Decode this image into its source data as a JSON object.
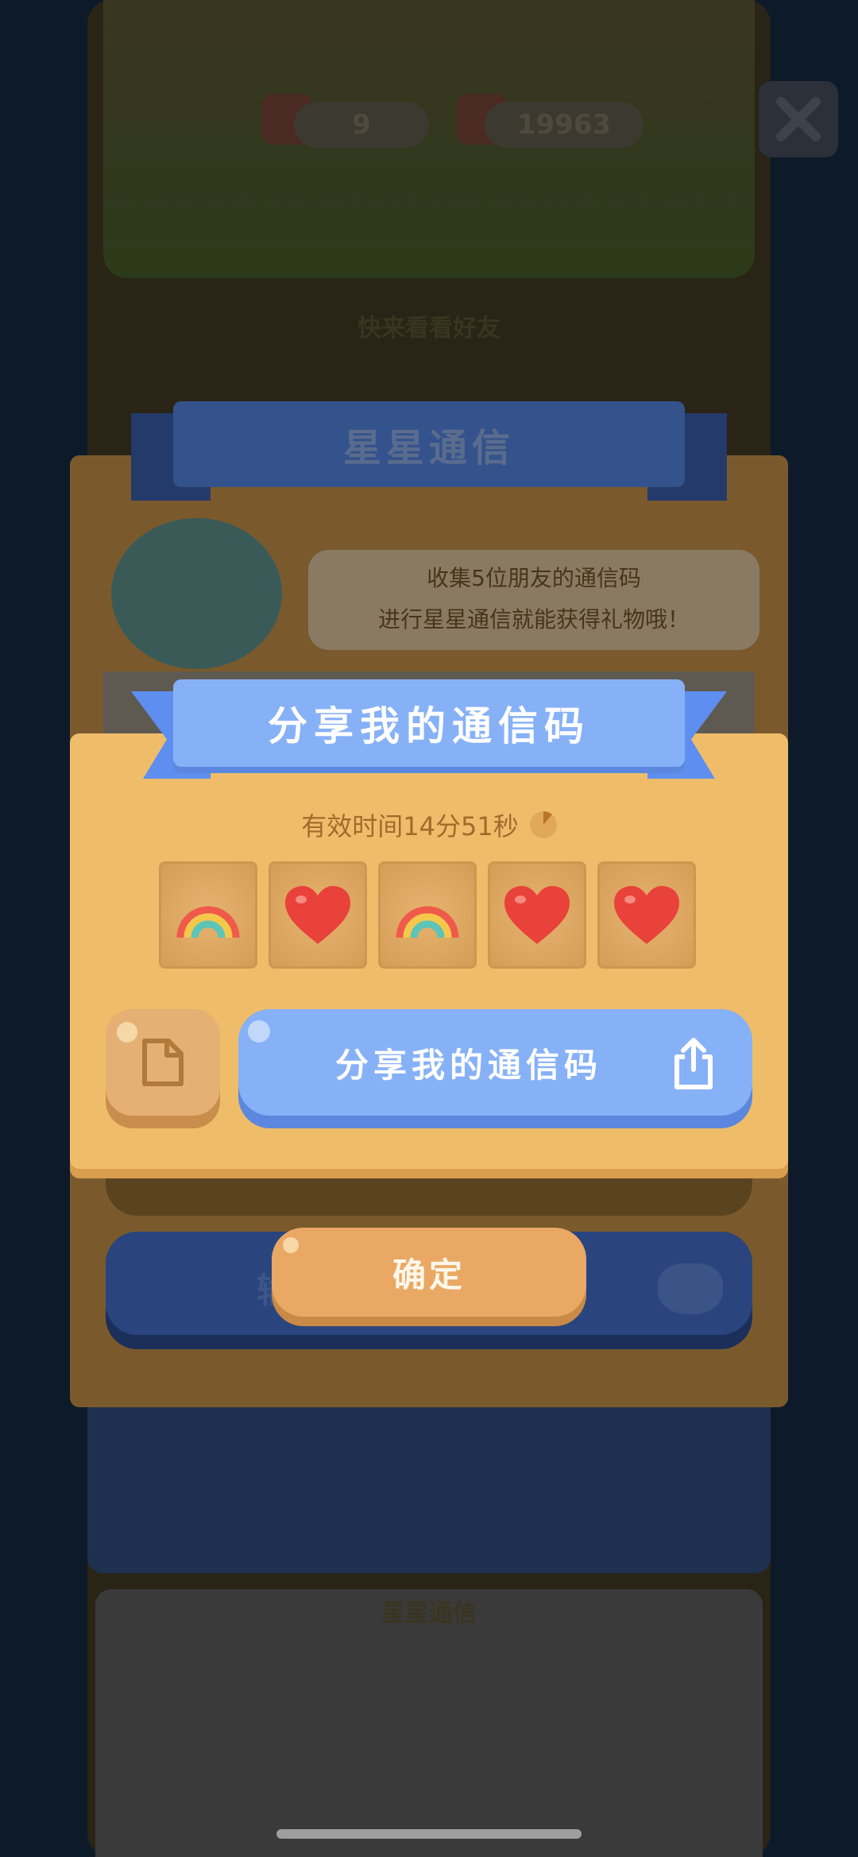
{
  "background": {
    "counters": [
      {
        "value": "9"
      },
      {
        "value": "19963"
      }
    ],
    "section_title_top": "快来看看好友",
    "section_title_bottom": "星星通信"
  },
  "back_dialog": {
    "title": "星星通信",
    "bubble_line1": "收集5位朋友的通信码",
    "bubble_line2": "进行星星通信就能获得礼物哦！",
    "partial_button_text": "输"
  },
  "share_dialog": {
    "title": "分享我的通信码",
    "timer_text": "有效时间14分51秒",
    "timer_progress": 0.11,
    "code_tiles": [
      {
        "icon": "rainbow-icon"
      },
      {
        "icon": "heart-icon"
      },
      {
        "icon": "rainbow-icon"
      },
      {
        "icon": "heart-icon"
      },
      {
        "icon": "heart-icon"
      }
    ],
    "share_button_label": "分享我的通信码",
    "copy_button_icon": "copy-icon",
    "share_button_icon": "share-icon"
  },
  "confirm_button_label": "确定",
  "colors": {
    "dialog_orange": "#efbd6a",
    "ribbon_blue": "#87b1f7",
    "confirm_orange": "#e9a964",
    "timer_text": "#a26a2c"
  }
}
